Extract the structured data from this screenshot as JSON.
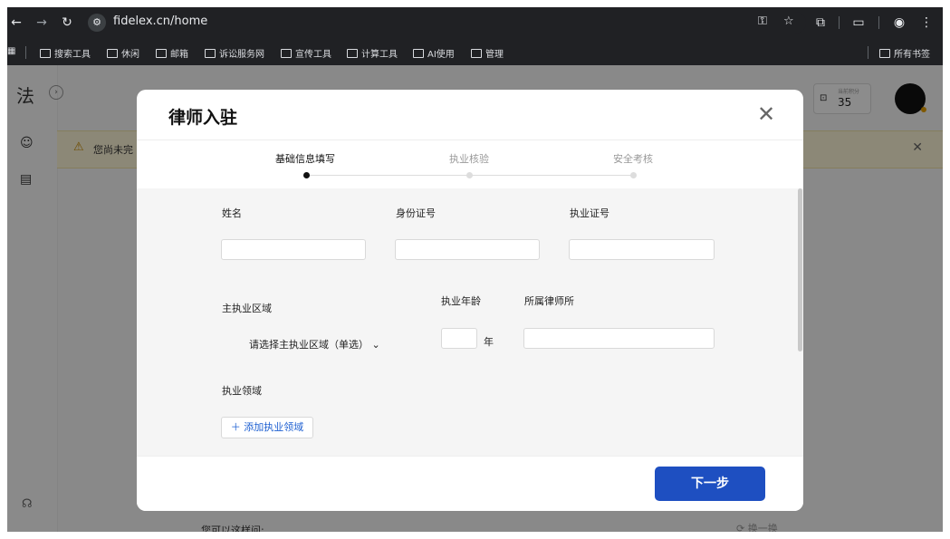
{
  "browser": {
    "url": "fidelex.cn/home",
    "bookmarks": [
      "搜索工具",
      "休闲",
      "邮箱",
      "诉讼服务网",
      "宣传工具",
      "计算工具",
      "AI使用",
      "管理"
    ],
    "all_bookmarks": "所有书签"
  },
  "page": {
    "logo": "法",
    "warning": "您尚未完",
    "points_label": "当前积分",
    "points_value": "35",
    "bottom_text": "您可以这样问:",
    "bottom_right": "换一换"
  },
  "modal": {
    "title": "律师入驻",
    "steps": [
      {
        "label": "基础信息填写",
        "active": true
      },
      {
        "label": "执业核验",
        "active": false
      },
      {
        "label": "安全考核",
        "active": false
      }
    ],
    "fields": {
      "name_label": "姓名",
      "id_label": "身份证号",
      "license_label": "执业证号",
      "region_label": "主执业区域",
      "region_select": "请选择主执业区域（单选）",
      "years_label": "执业年龄",
      "years_unit": "年",
      "firm_label": "所属律师所",
      "domain_label": "执业领域",
      "add_domain": "添加执业领域"
    },
    "next_button": "下一步"
  },
  "colors": {
    "primary": "#1e4fc1",
    "warning_bg": "#fff7d9"
  }
}
